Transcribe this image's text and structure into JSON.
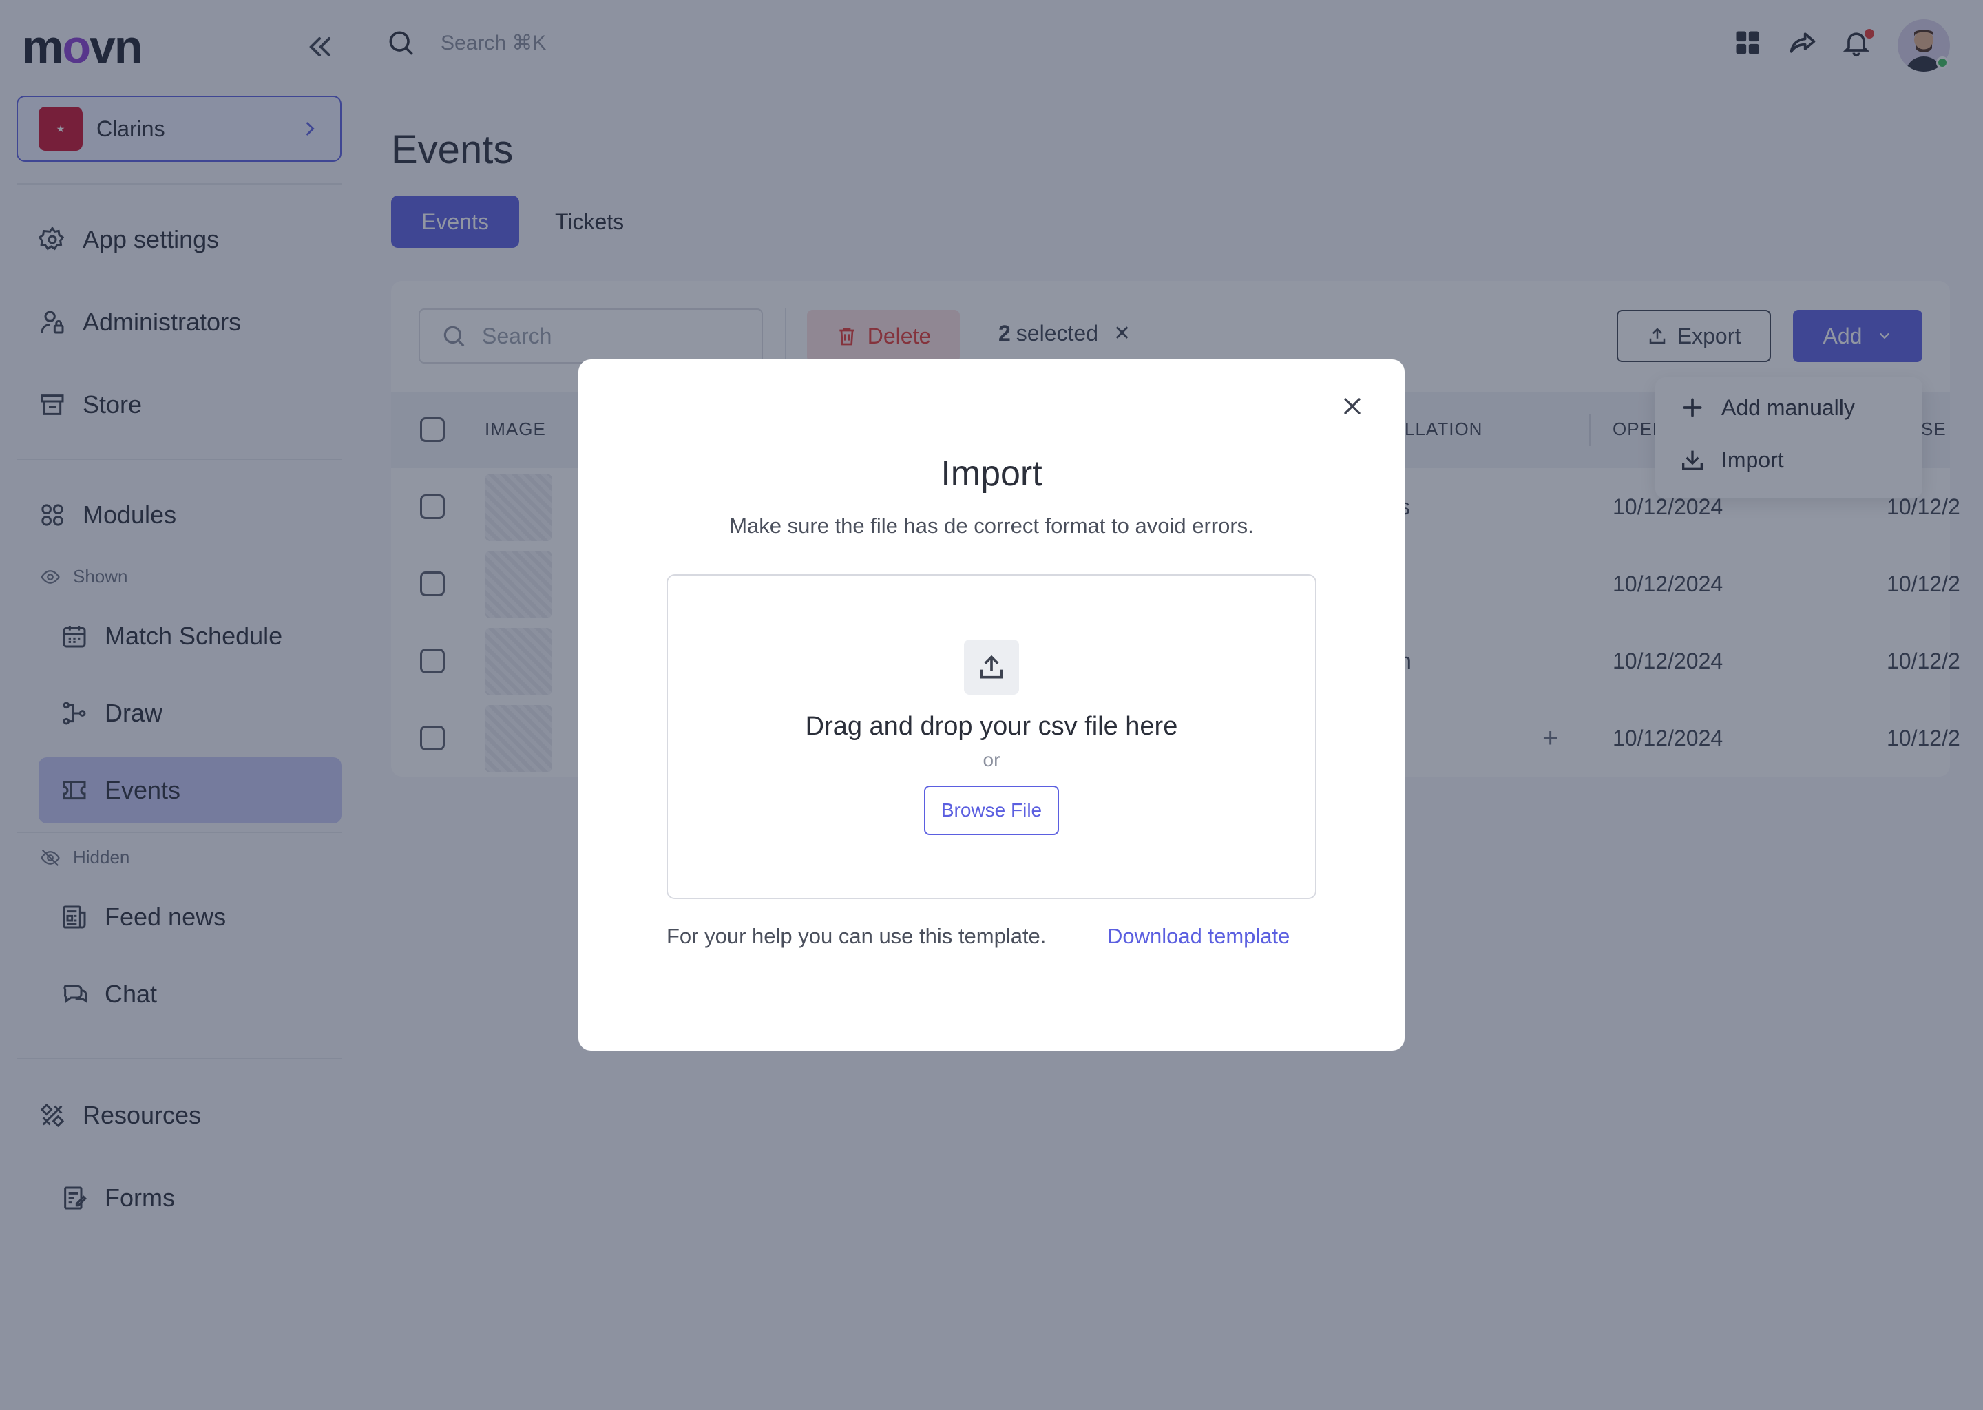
{
  "brand": {
    "logo_text_1": "m",
    "logo_text_2": "o",
    "logo_text_3": "vn",
    "accent": "#5b5fe0"
  },
  "topbar": {
    "search_placeholder": "Search ⌘K"
  },
  "org": {
    "name": "Clarins"
  },
  "sidebar": {
    "items": [
      {
        "label": "App settings",
        "icon": "gear-icon"
      },
      {
        "label": "Administrators",
        "icon": "user-lock-icon"
      },
      {
        "label": "Store",
        "icon": "store-icon"
      },
      {
        "label": "Modules",
        "icon": "modules-icon"
      }
    ],
    "shown_label": "Shown",
    "shown_items": [
      {
        "label": "Match Schedule",
        "icon": "calendar-icon"
      },
      {
        "label": "Draw",
        "icon": "bracket-icon"
      },
      {
        "label": "Events",
        "icon": "ticket-icon",
        "active": true
      }
    ],
    "hidden_label": "Hidden",
    "hidden_items": [
      {
        "label": "Feed news",
        "icon": "news-icon"
      },
      {
        "label": "Chat",
        "icon": "chat-icon"
      }
    ],
    "resources": {
      "label": "Resources",
      "icon": "resources-icon"
    },
    "forms": {
      "label": "Forms",
      "icon": "forms-icon"
    }
  },
  "main": {
    "title": "Events",
    "tabs": [
      {
        "label": "Events",
        "active": true
      },
      {
        "label": "Tickets",
        "active": false
      }
    ],
    "toolbar": {
      "search_placeholder": "Search",
      "delete_label": "Delete",
      "selected_count": "2",
      "selected_text": "selected",
      "export_label": "Export",
      "add_label": "Add"
    },
    "add_menu": [
      {
        "label": "Add manually",
        "icon": "plus-icon"
      },
      {
        "label": "Import",
        "icon": "import-icon"
      }
    ],
    "table": {
      "headers": {
        "image": "IMAGE",
        "cancellation": "LLATION",
        "open": "OPEN",
        "close": "SE"
      },
      "rows": [
        {
          "partial": "s",
          "open": "10/12/2024",
          "close": "10/12/2"
        },
        {
          "partial": "",
          "open": "10/12/2024",
          "close": "10/12/2"
        },
        {
          "partial": "n",
          "open": "10/12/2024",
          "close": "10/12/2"
        },
        {
          "partial": "",
          "open": "10/12/2024",
          "close": "10/12/2"
        }
      ]
    }
  },
  "modal": {
    "title": "Import",
    "subtitle": "Make sure the file has de correct format to avoid errors.",
    "dropzone_title": "Drag and drop your csv file here",
    "or": "or",
    "browse_label": "Browse File",
    "help_text": "For your help you can use this template.",
    "download_label": "Download template"
  }
}
